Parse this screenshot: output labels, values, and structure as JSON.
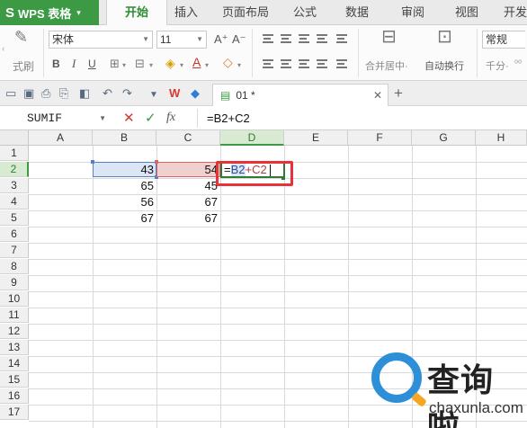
{
  "app": {
    "logo_glyph": "S",
    "name": "WPS 表格",
    "menu_caret": "▾"
  },
  "menu_tabs": [
    "开始",
    "插入",
    "页面布局",
    "公式",
    "数据",
    "审阅",
    "视图",
    "开发"
  ],
  "ribbon": {
    "format_painter": "式刷",
    "font_name": "宋体",
    "font_size": "11",
    "grow_font": "A⁺",
    "shrink_font": "A⁻",
    "bold": "B",
    "italic": "I",
    "underline": "U",
    "merge_center": "合并居中·",
    "wrap_text": "自动换行",
    "number_format": "常规",
    "number_format_2": "千分·"
  },
  "file_tab": {
    "name": "01 *",
    "close": "✕",
    "add": "+"
  },
  "formula_bar": {
    "name_box": "SUMIF",
    "cancel": "✕",
    "confirm": "✓",
    "fx": "fx",
    "formula": "=B2+C2"
  },
  "columns": [
    "A",
    "B",
    "C",
    "D",
    "E",
    "F",
    "G",
    "H"
  ],
  "rows": [
    "1",
    "2",
    "3",
    "4",
    "5",
    "6",
    "7",
    "8",
    "9",
    "10",
    "11",
    "12",
    "13",
    "14",
    "15",
    "16",
    "17"
  ],
  "cells": {
    "B2": "43",
    "C2": "54",
    "B3": "65",
    "C3": "45",
    "B4": "56",
    "C4": "67",
    "B5": "67",
    "C5": "67"
  },
  "edit": {
    "eq": "=",
    "ref_b": "B2",
    "plus_c": "+C2"
  },
  "watermark": {
    "title": "查询啦",
    "domain": "chaxunla.com"
  },
  "colors": {
    "accent": "#3c9a44",
    "ref_b": "#5b7fc7",
    "ref_c": "#d36868",
    "highlight": "#e8323a"
  }
}
